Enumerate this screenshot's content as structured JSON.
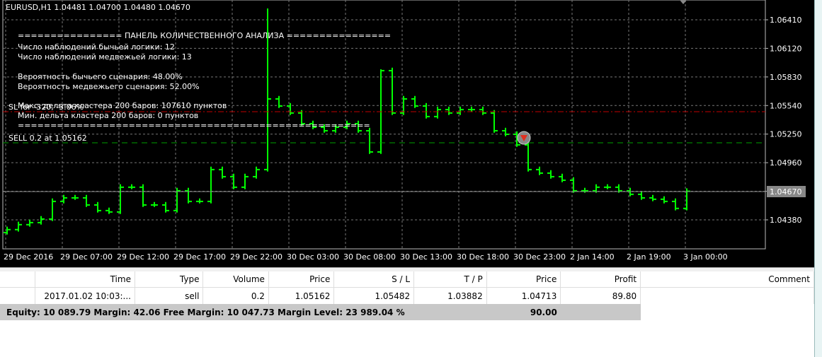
{
  "chart_header": "EURUSD,H1  1.04481 1.04700 1.04480 1.04670",
  "panel": {
    "title": "================  ПАНЕЛЬ КОЛИЧЕСТВЕННОГО АНАЛИЗА  ================",
    "bull_count": "Число наблюдений бычьей логики: 12",
    "bear_count": "Число наблюдений медвежьей логики: 13",
    "bull_prob": "Вероятность бычьего сценария: 48.00%",
    "bear_prob": "Вероятность медвежьего сценария: 52.00%",
    "max_delta": "Макс. дельта кластера 200 баров: 107610 пунктов",
    "min_delta": "Мин. дельта кластера 200 баров: 0 пунктов",
    "footer": "======================================================"
  },
  "sl_label": "SL for -320, -3.06%",
  "order_label": "SELL 0.2 at 1.05162",
  "current_price": "1.04670",
  "price_axis": [
    "1.06410",
    "1.06120",
    "1.05830",
    "1.05540",
    "1.05250",
    "1.04960",
    "1.04670",
    "1.04380"
  ],
  "time_axis": [
    "29 Dec 2016",
    "29 Dec 07:00",
    "29 Dec 12:00",
    "29 Dec 17:00",
    "29 Dec 22:00",
    "30 Dec 03:00",
    "30 Dec 08:00",
    "30 Dec 13:00",
    "30 Dec 18:00",
    "30 Dec 23:00",
    "2 Jan 14:00",
    "2 Jan 19:00",
    "3 Jan 00:00"
  ],
  "colors": {
    "bars": "#00ff00",
    "sl": "#c00000",
    "order": "#00a000",
    "grid": "#777777"
  },
  "chart_data": {
    "type": "ohlc",
    "symbol": "EURUSD",
    "timeframe": "H1",
    "ylim": [
      1.0423,
      1.0665
    ],
    "sl_price": 1.05482,
    "order_price": 1.05162,
    "last": 1.0467,
    "closes": [
      1.04281,
      1.04331,
      1.04352,
      1.04388,
      1.04567,
      1.04603,
      1.04603,
      1.04531,
      1.04474,
      1.0446,
      1.04711,
      1.04711,
      1.04531,
      1.04531,
      1.04474,
      1.04675,
      1.04567,
      1.04567,
      1.0489,
      1.04818,
      1.04711,
      1.04818,
      1.0489,
      1.05607,
      1.05535,
      1.05464,
      1.05356,
      1.0532,
      1.05284,
      1.0532,
      1.05356,
      1.05284,
      1.05069,
      1.05894,
      1.05464,
      1.05607,
      1.05535,
      1.05428,
      1.05499,
      1.05464,
      1.05499,
      1.05499,
      1.05464,
      1.05284,
      1.05248,
      1.05141,
      1.0489,
      1.04854,
      1.04818,
      1.04782,
      1.04675,
      1.04675,
      1.04711,
      1.04711,
      1.04675,
      1.04639,
      1.04603,
      1.04589,
      1.04567,
      1.04496,
      1.0467
    ],
    "spike_high": {
      "23": 1.06525,
      "33": 1.05908
    }
  },
  "table": {
    "headers": [
      "Time",
      "Type",
      "Volume",
      "Price",
      "S / L",
      "T / P",
      "Price",
      "Profit",
      "Comment"
    ],
    "row": [
      "2017.01.02 10:03:...",
      "sell",
      "0.2",
      "1.05162",
      "1.05482",
      "1.03882",
      "1.04713",
      "89.80",
      ""
    ],
    "summary": "Equity: 10 089.79  Margin: 42.06  Free Margin: 10 047.73  Margin Level: 23 989.04 %",
    "summary_profit": "90.00"
  }
}
